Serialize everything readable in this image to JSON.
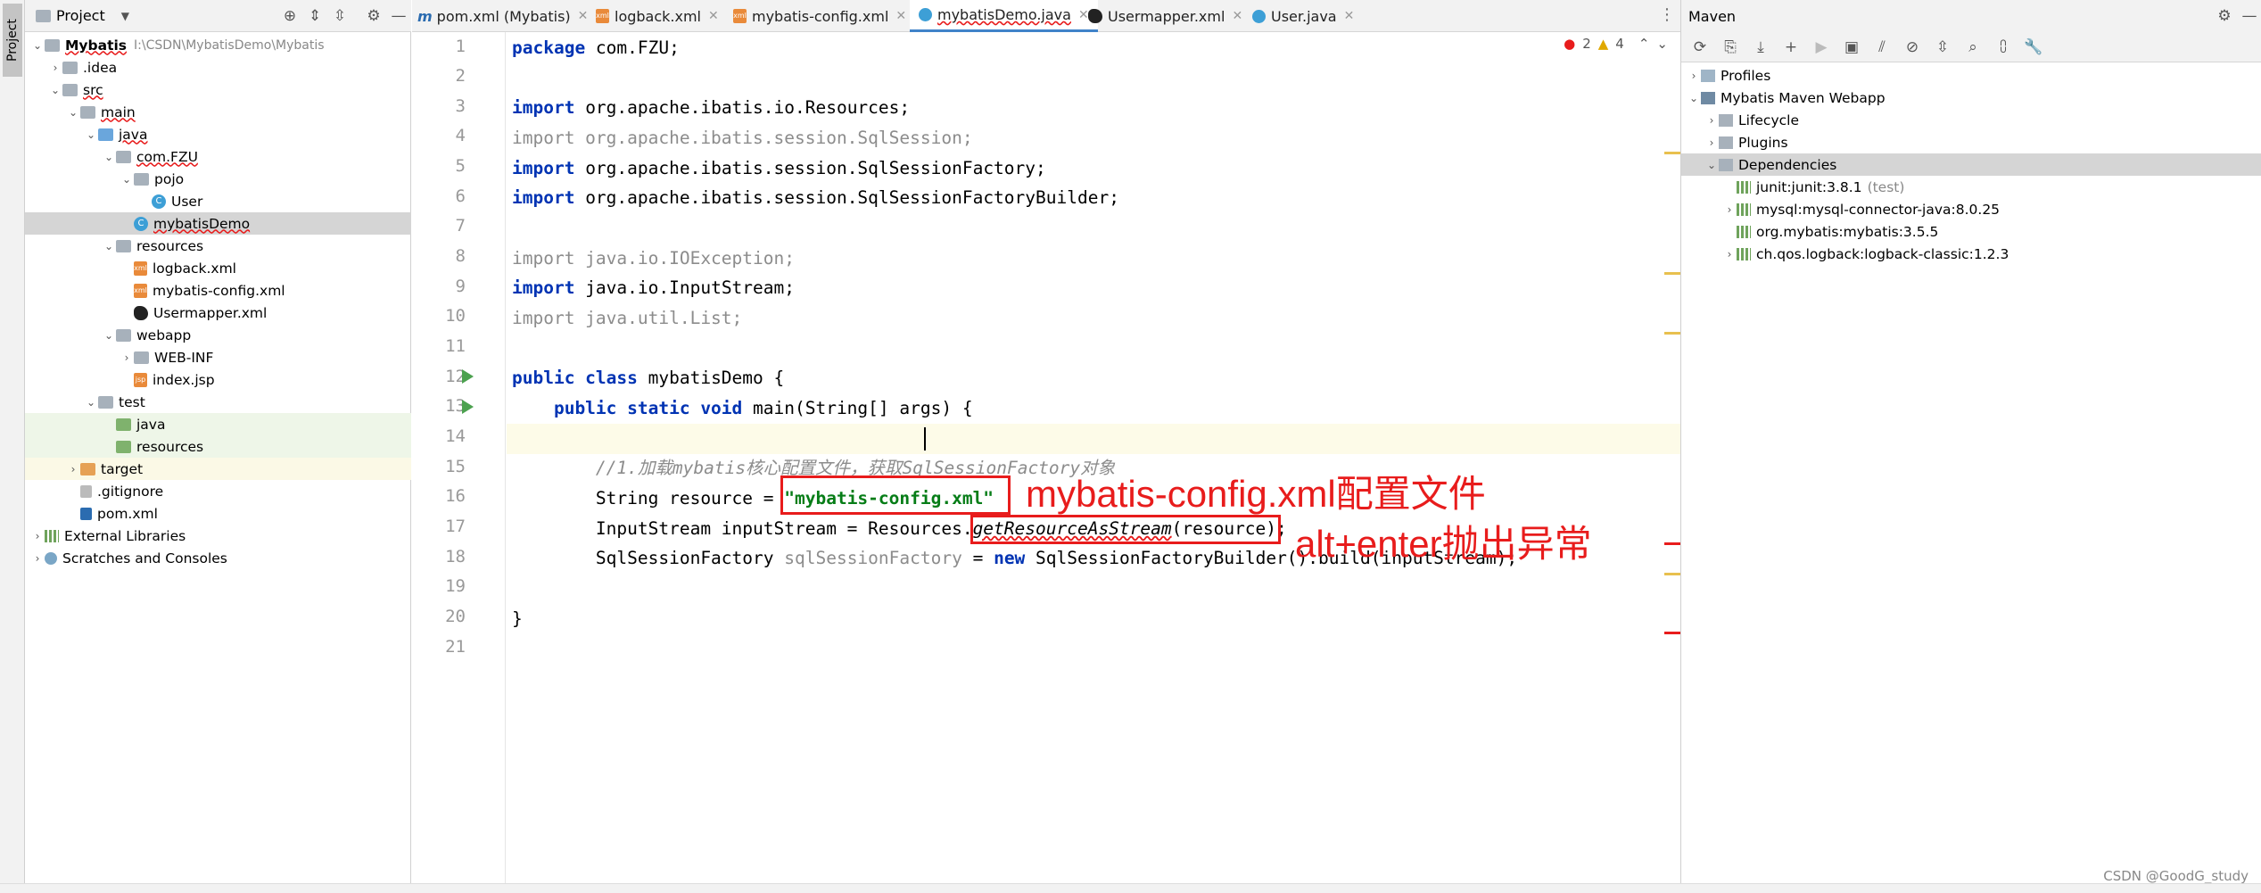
{
  "left_stripe": {
    "project_label": "Project"
  },
  "project_panel": {
    "title": "Project",
    "tree": [
      {
        "label": "Mybatis",
        "hint": "I:\\CSDN\\MybatisDemo\\Mybatis"
      },
      {
        "label": ".idea"
      },
      {
        "label": "src"
      },
      {
        "label": "main"
      },
      {
        "label": "java"
      },
      {
        "label": "com.FZU"
      },
      {
        "label": "pojo"
      },
      {
        "label": "User"
      },
      {
        "label": "mybatisDemo"
      },
      {
        "label": "resources"
      },
      {
        "label": "logback.xml"
      },
      {
        "label": "mybatis-config.xml"
      },
      {
        "label": "Usermapper.xml"
      },
      {
        "label": "webapp"
      },
      {
        "label": "WEB-INF"
      },
      {
        "label": "index.jsp"
      },
      {
        "label": "test"
      },
      {
        "label": "java"
      },
      {
        "label": "resources"
      },
      {
        "label": "target"
      },
      {
        "label": ".gitignore"
      },
      {
        "label": "pom.xml"
      },
      {
        "label": "External Libraries"
      },
      {
        "label": "Scratches and Consoles"
      }
    ]
  },
  "editor": {
    "tabs": [
      {
        "label": "pom.xml (Mybatis)"
      },
      {
        "label": "logback.xml"
      },
      {
        "label": "mybatis-config.xml"
      },
      {
        "label": "mybatisDemo.java"
      },
      {
        "label": "Usermapper.xml"
      },
      {
        "label": "User.java"
      }
    ],
    "errors": "2",
    "warnings": "4",
    "line_numbers": [
      "1",
      "2",
      "3",
      "4",
      "5",
      "6",
      "7",
      "8",
      "9",
      "10",
      "11",
      "12",
      "13",
      "14",
      "15",
      "16",
      "17",
      "18",
      "19",
      "20",
      "21"
    ],
    "code": {
      "l1_kw": "package",
      "l1_rest": " com.FZU;",
      "l3_kw": "import",
      "l3_rest": " org.apache.ibatis.io.Resources;",
      "l4": "import org.apache.ibatis.session.SqlSession;",
      "l5_kw": "import",
      "l5_rest": " org.apache.ibatis.session.SqlSessionFactory;",
      "l6_kw": "import",
      "l6_rest": " org.apache.ibatis.session.SqlSessionFactoryBuilder;",
      "l8": "import java.io.IOException;",
      "l9_kw": "import",
      "l9_rest": " java.io.InputStream;",
      "l10": "import java.util.List;",
      "l12_kw": "public class",
      "l12_rest": " mybatisDemo {",
      "l13_kw": "    public static void",
      "l13_rest": " main(String[] args) {",
      "l15": "        //1.加载mybatis核心配置文件，获取SqlSessionFactory对象",
      "l16_a": "        String resource = ",
      "l16_str": "\"mybatis-config.xml\"",
      "l17_a": "        InputStream inputStream = Resources.",
      "l17_m": "getResourceAsStream",
      "l17_b": "(resource);",
      "l18_a": "        SqlSessionFactory ",
      "l18_var": "sqlSessionFactory",
      "l18_b": " = ",
      "l18_kw": "new",
      "l18_c": " SqlSessionFactoryBuilder().build(inputStream);",
      "l20": "}"
    },
    "annotations": {
      "a1": "mybatis-config.xml配置文件",
      "a2": "alt+enter抛出异常"
    }
  },
  "maven": {
    "title": "Maven",
    "tree": [
      {
        "label": "Profiles"
      },
      {
        "label": "Mybatis Maven Webapp"
      },
      {
        "label": "Lifecycle"
      },
      {
        "label": "Plugins"
      },
      {
        "label": "Dependencies"
      },
      {
        "label": "junit:junit:3.8.1",
        "suffix": "(test)"
      },
      {
        "label": "mysql:mysql-connector-java:8.0.25"
      },
      {
        "label": "org.mybatis:mybatis:3.5.5"
      },
      {
        "label": "ch.qos.logback:logback-classic:1.2.3"
      }
    ]
  },
  "watermark": "CSDN @GoodG_study",
  "colors": {
    "annotation": "#e81c1c",
    "keyword": "#0033b3",
    "string": "#067d17",
    "selection": "#d5d5d5",
    "test_bg": "#eef6e8"
  }
}
